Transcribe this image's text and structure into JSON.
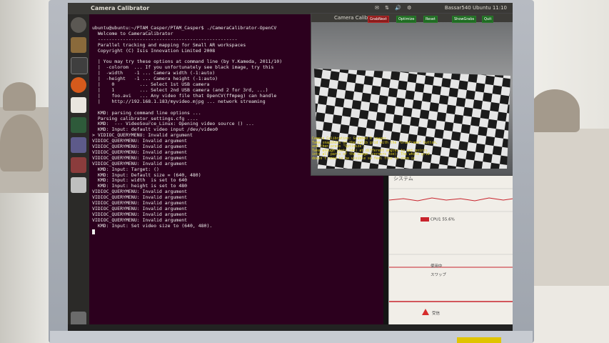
{
  "colors": {
    "terminal_bg": "#2c001e",
    "panel_bg": "#3a3936",
    "accent_red": "#c8232c",
    "button_green": "#1e6c22",
    "message_yellow": "#e7d51a"
  },
  "topbar": {
    "title": "Camera Calibrator",
    "right_text": "Bassar540 Ubuntu 11:10"
  },
  "launcher": {
    "items": [
      "dash-icon",
      "files-icon",
      "terminal-icon",
      "firefox-icon",
      "writer-icon",
      "sysmon-icon",
      "help-icon",
      "settings-icon",
      "workspace-icon",
      "trash-icon"
    ]
  },
  "terminal": {
    "lines": [
      "ubuntu@ubuntu:~/PTAM_Casper/PTAM_Casper$ ./CameraCalibrator-OpenCV",
      "  Welcome to CameraCalibrator",
      "  --------------------------------------------------",
      "  Parallel tracking and mapping for Small AR workspaces",
      "  Copyright (C) Isis Innovation Limited 2008",
      "",
      "  | You may try these options at command line (by Y.Kameda, 2011/10)",
      "  |  -colorom  ... If you unfortunately see black image, try this",
      "  |  -width    -1 ... Camera width (-1:auto)",
      "  |  -height   -1 ... Camera height (-1:auto)",
      "  |    0         ... Select 1st USB camera",
      "  |    1         ... Select 2nd USB camera (and 2 for 3rd, ...)",
      "  |    foo.avi   ... Any video file that OpenCV(ffmpeg) can handle",
      "  |    http://192.168.1.183/myvideo.mjpg ... network streaming",
      "",
      "  KMD: parsing command line options ...",
      "  Parsing calibrator_settings.cfg ....",
      "  KMD:  --- VideoSource_Linux: Opening video source () ...",
      "  KMD: Input: default video input /dev/video0",
      "> VIDIOC_QUERYMENU: Invalid argument",
      "VIDIOC_QUERYMENU: Invalid argument",
      "VIDIOC_QUERYMENU: Invalid argument",
      "VIDIOC_QUERYMENU: Invalid argument",
      "VIDIOC_QUERYMENU: Invalid argument",
      "VIDIOC_QUERYMENU: Invalid argument",
      "  KMD: Input: Target: ()",
      "  KMD: Input: Default size = (640, 480)",
      "  KMD: Input: width  is set to 640",
      "  KMD: Input: height is set to 480",
      "VIDIOC_QUERYMENU: Invalid argument",
      "VIDIOC_QUERYMENU: Invalid argument",
      "VIDIOC_QUERYMENU: Invalid argument",
      "VIDIOC_QUERYMENU: Invalid argument",
      "VIDIOC_QUERYMENU: Invalid argument",
      "VIDIOC_QUERYMENU: Invalid argument",
      "  KMD: Input: Set video size to (640, 480)."
    ]
  },
  "camera_window": {
    "title": "Camera Calibrator",
    "buttons": [
      "GrabNext",
      "Optimize",
      "Reset",
      "ShowGrabs",
      "Quit"
    ],
    "message": "Camera Calibration: Grabbed 0 images.\nTake snapshots of the calib grid with the \"GrabFrame\" button,\nand then press \"Optimize\".\nTake enough shots (4+) at different angles to get points\ninto all parts of the image (corners too). The whole grid\ndoesn't need to be visible so feel free to zoom in."
  },
  "system_monitor": {
    "title": "システム",
    "cpu_label": "CPU1 55.6%",
    "memory_label": "使用中",
    "swap_label": "スワップ",
    "network_label": "受信"
  }
}
